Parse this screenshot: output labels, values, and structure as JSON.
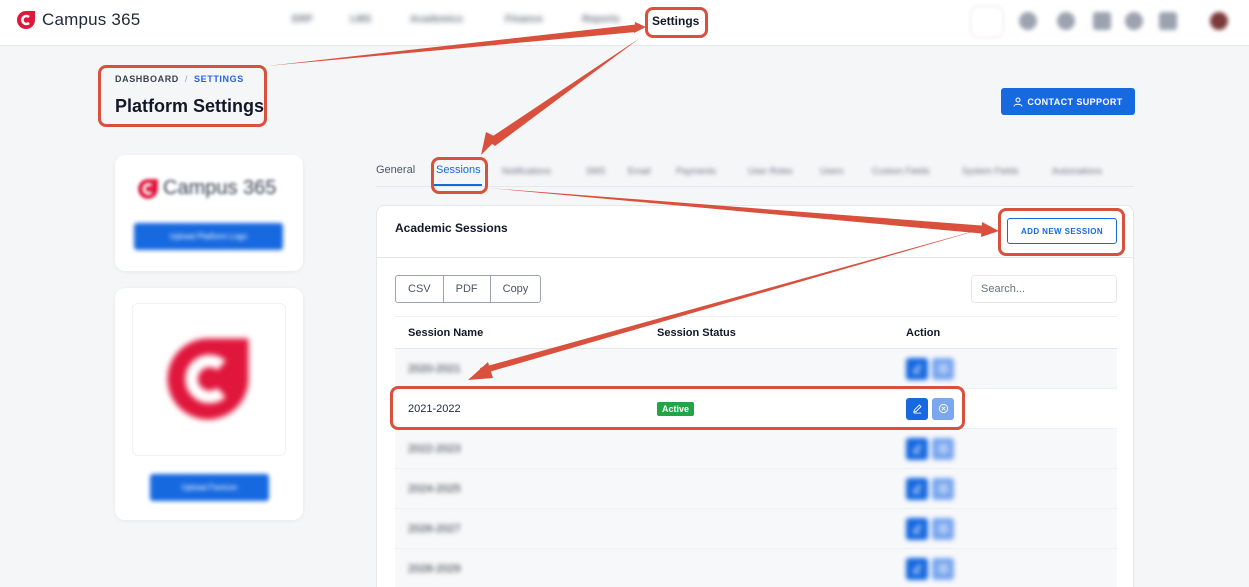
{
  "app": {
    "brand": "Campus 365",
    "nav_active": "Settings",
    "nav_blurred": [
      "ERP",
      "LMS",
      "Academics",
      "Finance",
      "Reports"
    ]
  },
  "header": {
    "breadcrumb_root": "DASHBOARD",
    "breadcrumb_sep": "/",
    "breadcrumb_current": "SETTINGS",
    "title": "Platform Settings",
    "contact_label": "CONTACT SUPPORT"
  },
  "tabs": {
    "general": "General",
    "sessions": "Sessions",
    "blurred": [
      "Notifications",
      "SMS",
      "Email",
      "Payments",
      "User Roles",
      "Users",
      "Custom Fields",
      "System Fields",
      "Automations"
    ]
  },
  "sidebar": {
    "platform_logo_text": "Campus 365",
    "upload_logo_label": "Upload Platform Logo",
    "upload_favicon_label": "Upload Favicon"
  },
  "panel": {
    "title": "Academic Sessions",
    "add_label": "ADD NEW SESSION",
    "export_buttons": [
      "CSV",
      "PDF",
      "Copy"
    ],
    "search_placeholder": "Search...",
    "columns": [
      "Session Name",
      "Session Status",
      "Action"
    ],
    "rows": [
      {
        "name": "2020-2021",
        "status": "",
        "blurred": true
      },
      {
        "name": "2021-2022",
        "status": "Active",
        "blurred": false
      },
      {
        "name": "2022-2023",
        "status": "",
        "blurred": true
      },
      {
        "name": "2024-2025",
        "status": "",
        "blurred": true
      },
      {
        "name": "2026-2027",
        "status": "",
        "blurred": true
      },
      {
        "name": "2028-2029",
        "status": "",
        "blurred": true
      }
    ]
  },
  "colors": {
    "primary": "#1769e0",
    "active_badge": "#22a447",
    "annotation": "#d9503c",
    "brand_red": "#e0163c"
  },
  "icons": [
    "campus-logo-icon",
    "search-icon",
    "user-icon",
    "edit-icon",
    "close-circle-icon",
    "bell-icon"
  ]
}
